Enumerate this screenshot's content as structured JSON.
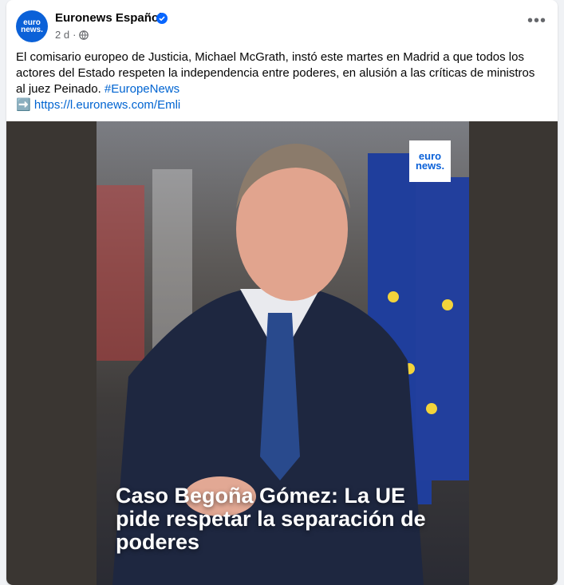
{
  "post": {
    "page_name": "Euronews Español",
    "time": "2 d",
    "text_main": "El comisario europeo de Justicia, Michael McGrath, instó este martes en Madrid a que todos los actores del Estado respeten la independencia entre poderes, en alusión a las críticas de ministros al juez Peinado.",
    "hashtag": "#EuropeNews",
    "link_arrow": "➡️",
    "link": "https://l.euronews.com/Emli"
  },
  "avatar": {
    "line1": "euro",
    "line2": "news."
  },
  "media": {
    "headline": "Caso Begoña Gómez: La UE pide respetar la separación de poderes",
    "logo_line1": "euro",
    "logo_line2": "news."
  },
  "icons": {
    "verified": "verified-badge-icon",
    "privacy": "globe-icon",
    "more": "more-options-icon"
  },
  "colors": {
    "brand": "#0b61d8",
    "link": "#0064d1",
    "text": "#050505",
    "muted": "#65676b"
  }
}
